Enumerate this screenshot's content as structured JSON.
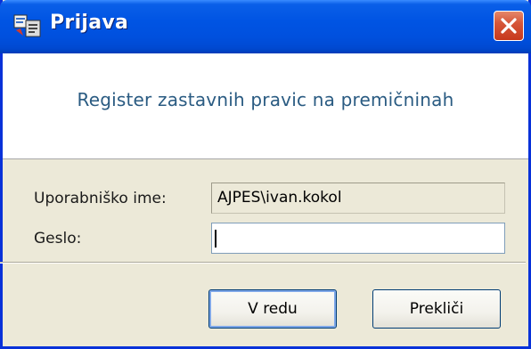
{
  "window": {
    "title": "Prijava",
    "app_icon": "register-app-icon",
    "close_icon": "close-icon"
  },
  "header": {
    "text": "Register zastavnih pravic na premičninah"
  },
  "form": {
    "username_label": "Uporabniško ime:",
    "username_value": "AJPES\\ivan.kokol",
    "password_label": "Geslo:",
    "password_value": ""
  },
  "buttons": {
    "ok_label": "V redu",
    "cancel_label": "Prekliči"
  },
  "colors": {
    "titlebar": "#0054e3",
    "header_text": "#2a5b82",
    "panel": "#ece9d8",
    "close_button": "#d6573a"
  }
}
